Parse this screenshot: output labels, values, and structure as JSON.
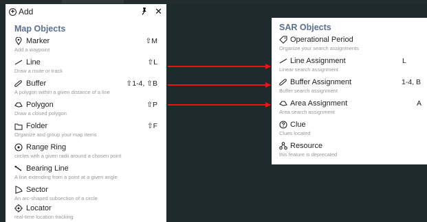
{
  "add_bar": {
    "add_label": "Add"
  },
  "map_objects": {
    "title": "Map Objects",
    "items": [
      {
        "label": "Marker",
        "description": "Add a waypoint",
        "shortcut": "⇧M",
        "icon": "location-pin-icon"
      },
      {
        "label": "Line",
        "description": "Draw a route or track",
        "shortcut": "⇧L",
        "icon": "line-icon"
      },
      {
        "label": "Buffer",
        "description": "A polygon within a given distance of a line",
        "shortcut": "⇧1-4, ⇧B",
        "icon": "buffer-icon"
      },
      {
        "label": "Polygon",
        "description": "Draw a closed polygon",
        "shortcut": "⇧P",
        "icon": "polygon-icon"
      },
      {
        "label": "Folder",
        "description": "Organize and group your map items",
        "shortcut": "⇧F",
        "icon": "folder-icon"
      },
      {
        "label": "Range Ring",
        "description": "circles with a given radii around a chosen point",
        "shortcut": "",
        "icon": "range-ring-icon"
      },
      {
        "label": "Bearing Line",
        "description": "A line extending from a point at a given angle",
        "shortcut": "",
        "icon": "bearing-line-icon"
      },
      {
        "label": "Sector",
        "description": "An arc-shaped subsection of a circle",
        "shortcut": "",
        "icon": "sector-icon"
      },
      {
        "label": "Locator",
        "description": "real-time location tracking",
        "shortcut": "",
        "icon": "locator-icon"
      }
    ]
  },
  "sar_objects": {
    "title": "SAR Objects",
    "items": [
      {
        "label": "Operational Period",
        "description": "Organize your search assignments",
        "shortcut": "",
        "icon": "tag-icon"
      },
      {
        "label": "Line Assignment",
        "description": "Linear search assignment",
        "shortcut": "L",
        "icon": "line-icon"
      },
      {
        "label": "Buffer Assignment",
        "description": "Buffer search assignment",
        "shortcut": "1-4, B",
        "icon": "buffer-icon"
      },
      {
        "label": "Area Assignment",
        "description": "Area search assignment",
        "shortcut": "A",
        "icon": "polygon-icon"
      },
      {
        "label": "Clue",
        "description": "Clues located",
        "shortcut": "",
        "icon": "question-circle-icon"
      },
      {
        "label": "Resource",
        "description": "this feature is deprecated",
        "shortcut": "",
        "icon": "resource-icon"
      }
    ]
  },
  "colors": {
    "arrow": "#e8141a",
    "section_title": "#5a6f8f",
    "background": "#1e2a2b"
  }
}
